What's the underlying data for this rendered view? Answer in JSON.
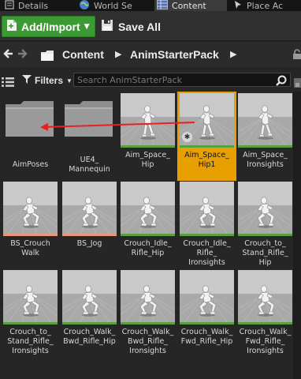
{
  "tabs": [
    {
      "label": "Details",
      "icon": "details-icon",
      "active": false
    },
    {
      "label": "World Se",
      "icon": "globe-icon",
      "active": false
    },
    {
      "label": "Content",
      "icon": "grid-icon",
      "active": true
    },
    {
      "label": "Place Ac",
      "icon": "place-actors-icon",
      "active": false
    }
  ],
  "toolbar": {
    "add_import_label": "Add/Import",
    "save_all_label": "Save All"
  },
  "path": {
    "crumbs": [
      "Content",
      "AnimStarterPack"
    ]
  },
  "filter": {
    "label": "Filters",
    "search_placeholder": "Search AnimStarterPack",
    "search_value": ""
  },
  "assets": [
    {
      "name": "AimPoses",
      "lines": [
        "AimPoses"
      ],
      "kind": "folder"
    },
    {
      "name": "UE4_Mannequin",
      "lines": [
        "UE4_",
        "Mannequin"
      ],
      "kind": "folder"
    },
    {
      "name": "Aim_Space_Hip",
      "lines": [
        "Aim_Space_",
        "Hip"
      ],
      "kind": "anim",
      "bar": "green"
    },
    {
      "name": "Aim_Space_Hip1",
      "lines": [
        "Aim_Space_",
        "Hip1"
      ],
      "kind": "anim",
      "bar": "green",
      "selected": true
    },
    {
      "name": "Aim_Space_Ironsights",
      "lines": [
        "Aim_Space_",
        "Ironsights"
      ],
      "kind": "anim",
      "bar": "green"
    },
    {
      "name": "BS_CrouchWalk",
      "lines": [
        "BS_Crouch",
        "Walk"
      ],
      "kind": "anim",
      "bar": "orange"
    },
    {
      "name": "BS_Jog",
      "lines": [
        "BS_Jog"
      ],
      "kind": "anim",
      "bar": "orange"
    },
    {
      "name": "Crouch_Idle_Rifle_Hip",
      "lines": [
        "Crouch_Idle_",
        "Rifle_Hip"
      ],
      "kind": "anim",
      "bar": "green"
    },
    {
      "name": "Crouch_Idle_Rifle_Ironsights",
      "lines": [
        "Crouch_Idle_",
        "Rifle_",
        "Ironsights"
      ],
      "kind": "anim",
      "bar": "green"
    },
    {
      "name": "Crouch_to_Stand_Rifle_Hip",
      "lines": [
        "Crouch_to_",
        "Stand_Rifle_",
        "Hip"
      ],
      "kind": "anim",
      "bar": "green"
    },
    {
      "name": "Crouch_to_Stand_Rifle_Ironsights",
      "lines": [
        "Crouch_to_",
        "Stand_Rifle_",
        "Ironsights"
      ],
      "kind": "anim",
      "bar": "green"
    },
    {
      "name": "Crouch_Walk_Bwd_Rifle_Hip",
      "lines": [
        "Crouch_Walk_",
        "Bwd_Rifle_Hip"
      ],
      "kind": "anim",
      "bar": "green"
    },
    {
      "name": "Crouch_Walk_Bwd_Rifle_Ironsights",
      "lines": [
        "Crouch_Walk_",
        "Bwd_Rifle_",
        "Ironsights"
      ],
      "kind": "anim",
      "bar": "green"
    },
    {
      "name": "Crouch_Walk_Fwd_Rifle_Hip",
      "lines": [
        "Crouch_Walk_",
        "Fwd_Rifle_Hip"
      ],
      "kind": "anim",
      "bar": "green"
    },
    {
      "name": "Crouch_Walk_Fwd_Rifle_Ironsights",
      "lines": [
        "Crouch_Walk_",
        "Fwd_Rifle_",
        "Ironsights"
      ],
      "kind": "anim",
      "bar": "green"
    }
  ],
  "annotation": {
    "arrow_color": "#e82020",
    "from_asset": "Aim_Space_Hip1",
    "to_asset": "AimPoses"
  },
  "colors": {
    "selection": "#e8a000",
    "add_button": "#3c9a34",
    "anim_bar": "#58a040",
    "blendspace_bar": "#e9977a"
  }
}
